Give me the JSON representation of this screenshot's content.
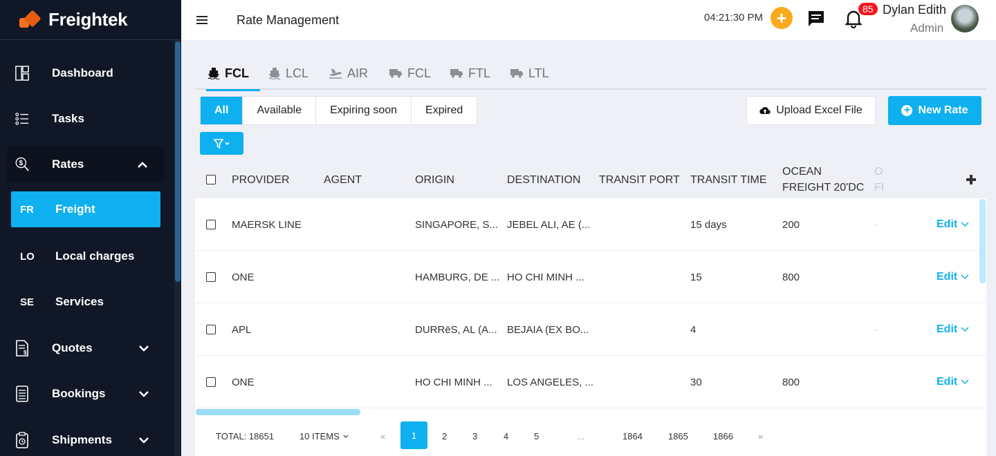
{
  "app": {
    "name": "Freightek"
  },
  "header": {
    "page_title": "Rate Management",
    "time": "04:21:30 PM",
    "notifications_count": "85",
    "user_name": "Dylan Edith",
    "user_role": "Admin"
  },
  "sidebar": {
    "items": [
      {
        "label": "Dashboard",
        "icon": "dashboard-icon"
      },
      {
        "label": "Tasks",
        "icon": "tasks-icon"
      },
      {
        "label": "Rates",
        "icon": "rates-icon",
        "expanded": true
      },
      {
        "label": "Quotes",
        "icon": "quotes-icon"
      },
      {
        "label": "Bookings",
        "icon": "bookings-icon"
      },
      {
        "label": "Shipments",
        "icon": "shipments-icon"
      }
    ],
    "sub_items": [
      {
        "abbr": "FR",
        "label": "Freight",
        "active": true
      },
      {
        "abbr": "LO",
        "label": "Local charges"
      },
      {
        "abbr": "SE",
        "label": "Services"
      }
    ]
  },
  "mode_tabs": [
    {
      "label": "FCL",
      "icon": "ship-icon",
      "active": true
    },
    {
      "label": "LCL",
      "icon": "ship-icon"
    },
    {
      "label": "AIR",
      "icon": "plane-icon"
    },
    {
      "label": "FCL",
      "icon": "truck-icon"
    },
    {
      "label": "FTL",
      "icon": "truck-icon"
    },
    {
      "label": "LTL",
      "icon": "truck-icon"
    }
  ],
  "status_filters": [
    "All",
    "Available",
    "Expiring soon",
    "Expired"
  ],
  "actions": {
    "upload": "Upload Excel File",
    "new_rate": "New Rate"
  },
  "table": {
    "columns": [
      "PROVIDER",
      "AGENT",
      "ORIGIN",
      "DESTINATION",
      "TRANSIT PORT",
      "TRANSIT TIME",
      "OCEAN",
      "FREIGHT 20'DC",
      "O",
      "FI"
    ],
    "rows": [
      {
        "provider": "MAERSK LINE",
        "agent": "",
        "origin": "SINGAPORE, S...",
        "destination": "JEBEL ALI, AE (...",
        "transit_port": "",
        "transit_time": "15 days",
        "ocean_20dc": "200",
        "next": "-",
        "action": "Edit"
      },
      {
        "provider": "ONE",
        "agent": "",
        "origin": "HAMBURG, DE ...",
        "destination": "HO CHI MINH ...",
        "transit_port": "",
        "transit_time": "15",
        "ocean_20dc": "800",
        "next": "",
        "action": "Edit"
      },
      {
        "provider": "APL",
        "agent": "",
        "origin": "DURRëS, AL (A...",
        "destination": "BEJAIA (EX BO...",
        "transit_port": "",
        "transit_time": "4",
        "ocean_20dc": "",
        "next": "-",
        "action": "Edit"
      },
      {
        "provider": "ONE",
        "agent": "",
        "origin": "HO CHI MINH ...",
        "destination": "LOS ANGELES, ...",
        "transit_port": "",
        "transit_time": "30",
        "ocean_20dc": "800",
        "next": "",
        "action": "Edit"
      }
    ]
  },
  "pagination": {
    "total": "TOTAL: 18651",
    "per_page": "10 ITEMS",
    "prev": "«",
    "pages": [
      "1",
      "2",
      "3",
      "4",
      "5",
      "...",
      "1864",
      "1865",
      "1866"
    ],
    "next": "»",
    "current": "1"
  },
  "colors": {
    "accent": "#0eb0ef",
    "sidebar_bg": "#101827",
    "brand_orange": "#f37021",
    "badge_red": "#f7141c"
  }
}
